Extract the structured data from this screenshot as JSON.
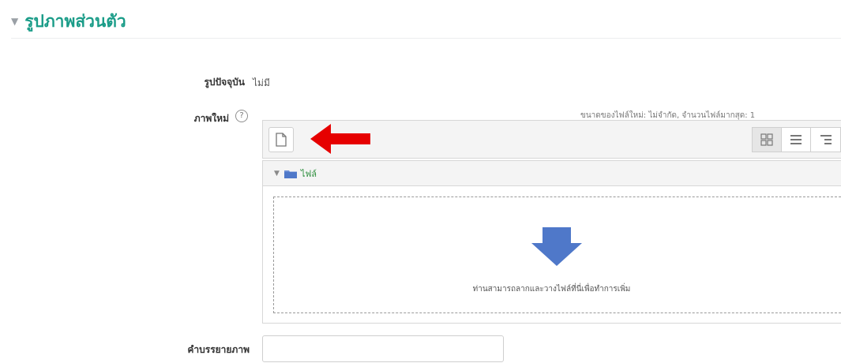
{
  "section": {
    "caret": "▼",
    "title": "รูปภาพส่วนตัว"
  },
  "current_picture": {
    "label": "รูปปัจจุบัน",
    "value": "ไม่มี"
  },
  "new_picture": {
    "label": "ภาพใหม่",
    "help": "?",
    "limits": "ขนาดของไฟล์ใหม่: ไม่จำกัด, จำนวนไฟล์มากสุด: 1",
    "path_toggle": "▼",
    "path_label": "ไฟล์",
    "drop_message": "ท่านสามารถลากและวางไฟล์ที่นี่เพื่อทำการเพิ่ม"
  },
  "description": {
    "label": "คำบรรยายภาพ",
    "value": ""
  },
  "colors": {
    "accent": "#1a9c88",
    "annotation_arrow": "#e60000",
    "drop_arrow": "#4f78c9"
  }
}
